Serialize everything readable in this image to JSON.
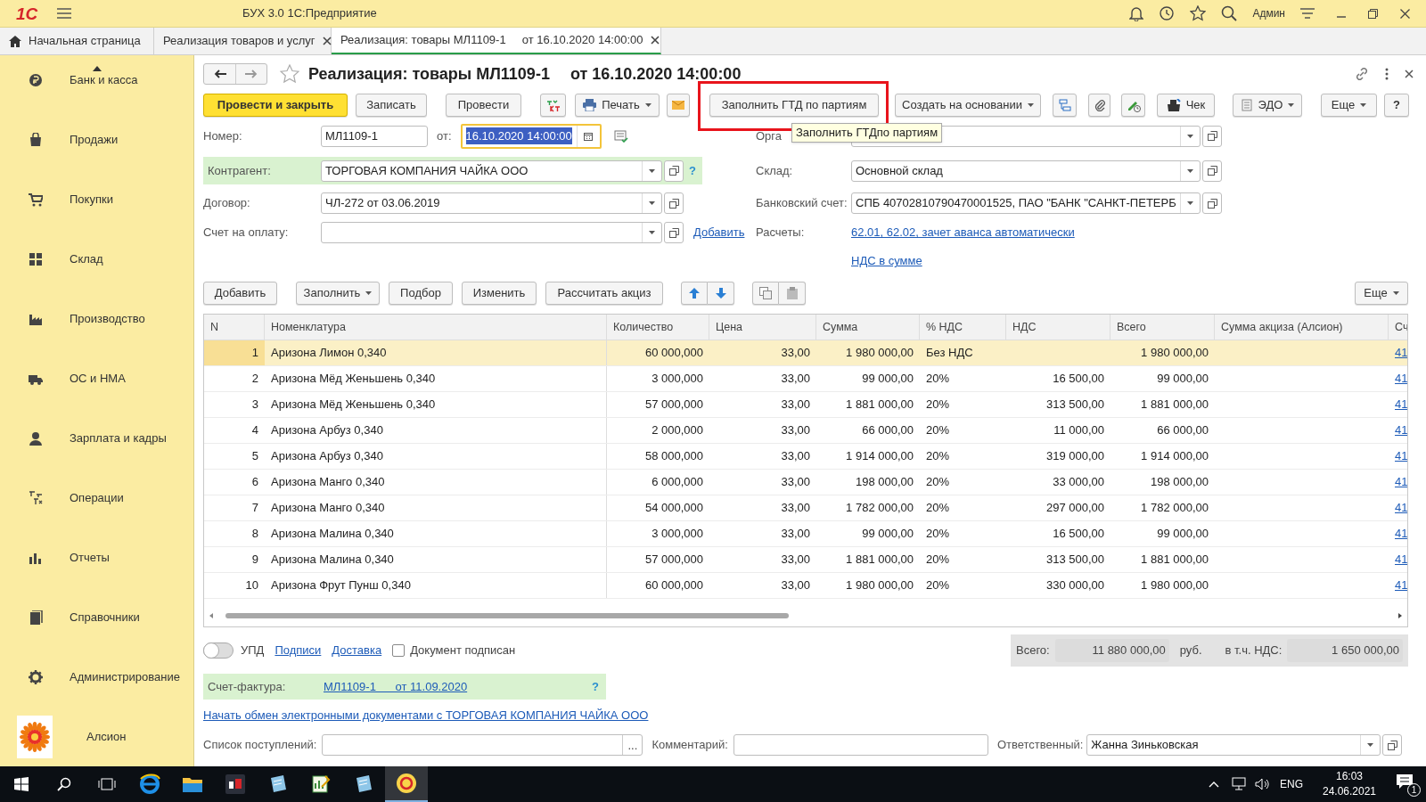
{
  "window": {
    "logo": "1С",
    "title": "БУХ 3.0 1С:Предприятие",
    "user": "Админ"
  },
  "tabs": [
    {
      "label": "Начальная страница",
      "selected": false,
      "closable": false
    },
    {
      "label": "Реализация товаров и услуг",
      "selected": false,
      "closable": true
    },
    {
      "label": "Реализация: товары МЛ1109-1     от 16.10.2020 14:00:00",
      "selected": true,
      "closable": true
    }
  ],
  "sidebar": {
    "items": [
      {
        "label": "Банк и касса"
      },
      {
        "label": "Продажи"
      },
      {
        "label": "Покупки"
      },
      {
        "label": "Склад"
      },
      {
        "label": "Производство"
      },
      {
        "label": "ОС и НМА"
      },
      {
        "label": "Зарплата и кадры"
      },
      {
        "label": "Операции"
      },
      {
        "label": "Отчеты"
      },
      {
        "label": "Справочники"
      },
      {
        "label": "Администрирование"
      },
      {
        "label": "Алсион"
      }
    ]
  },
  "document": {
    "title": "Реализация: товары МЛ1109-1",
    "date": "от 16.10.2020 14:00:00",
    "favorite": false
  },
  "toolbar": {
    "post_close": "Провести и закрыть",
    "save": "Записать",
    "post": "Провести",
    "print": "Печать",
    "fill_gtd": {
      "label": "Заполнить ГТД по партиям",
      "highlighted": true
    },
    "create_based": "Создать на основании",
    "receipt": "Чек",
    "edo": "ЭДО",
    "more": "Еще",
    "help": "?"
  },
  "tooltip": "Заполнить ГТДпо партиям",
  "fields": {
    "number": {
      "label": "Номер:",
      "value": "МЛ1109-1"
    },
    "date": {
      "label": "от:",
      "value": "16.10.2020 14:00:00",
      "selected": true
    },
    "counterparty": {
      "label": "Контрагент:",
      "value": "ТОРГОВАЯ КОМПАНИЯ ЧАЙКА ООО",
      "help": "?"
    },
    "contract": {
      "label": "Договор:",
      "value": "ЧЛ-272 от 03.06.2019"
    },
    "payment_invoice": {
      "label": "Счет на оплату:",
      "link": "Добавить"
    },
    "organization": {
      "label": "Орга"
    },
    "warehouse": {
      "label": "Склад:",
      "value": "Основной склад"
    },
    "bank_account": {
      "label": "Банковский счет:",
      "value": "СПБ 40702810790470001525, ПАО \"БАНК \"САНКТ-ПЕТЕРБ"
    },
    "settlements": {
      "label": "Расчеты:",
      "link": "62.01, 62.02, зачет аванса автоматически"
    },
    "vat_link": "НДС в сумме"
  },
  "table_toolbar": {
    "add": "Добавить",
    "fill": "Заполнить",
    "pick": "Подбор",
    "edit": "Изменить",
    "excise": "Рассчитать акциз",
    "more": "Еще"
  },
  "table": {
    "columns": [
      "N",
      "Номенклатура",
      "Количество",
      "Цена",
      "Сумма",
      "% НДС",
      "НДС",
      "Всего",
      "Сумма акциза (Алсион)",
      "Сч"
    ],
    "rows": [
      {
        "selected": true,
        "cells": [
          "1",
          "Аризона Лимон 0,340",
          "60 000,000",
          "33,00",
          "1 980 000,00",
          "Без НДС",
          "",
          "1 980 000,00",
          "",
          "41"
        ]
      },
      {
        "selected": false,
        "cells": [
          "2",
          "Аризона Мёд Женьшень 0,340",
          "3 000,000",
          "33,00",
          "99 000,00",
          "20%",
          "16 500,00",
          "99 000,00",
          "",
          "41"
        ]
      },
      {
        "selected": false,
        "cells": [
          "3",
          "Аризона Мёд Женьшень 0,340",
          "57 000,000",
          "33,00",
          "1 881 000,00",
          "20%",
          "313 500,00",
          "1 881 000,00",
          "",
          "41"
        ]
      },
      {
        "selected": false,
        "cells": [
          "4",
          "Аризона Арбуз 0,340",
          "2 000,000",
          "33,00",
          "66 000,00",
          "20%",
          "11 000,00",
          "66 000,00",
          "",
          "41"
        ]
      },
      {
        "selected": false,
        "cells": [
          "5",
          "Аризона Арбуз 0,340",
          "58 000,000",
          "33,00",
          "1 914 000,00",
          "20%",
          "319 000,00",
          "1 914 000,00",
          "",
          "41"
        ]
      },
      {
        "selected": false,
        "cells": [
          "6",
          "Аризона Манго 0,340",
          "6 000,000",
          "33,00",
          "198 000,00",
          "20%",
          "33 000,00",
          "198 000,00",
          "",
          "41"
        ]
      },
      {
        "selected": false,
        "cells": [
          "7",
          "Аризона Манго 0,340",
          "54 000,000",
          "33,00",
          "1 782 000,00",
          "20%",
          "297 000,00",
          "1 782 000,00",
          "",
          "41"
        ]
      },
      {
        "selected": false,
        "cells": [
          "8",
          "Аризона Малина 0,340",
          "3 000,000",
          "33,00",
          "99 000,00",
          "20%",
          "16 500,00",
          "99 000,00",
          "",
          "41"
        ]
      },
      {
        "selected": false,
        "cells": [
          "9",
          "Аризона Малина 0,340",
          "57 000,000",
          "33,00",
          "1 881 000,00",
          "20%",
          "313 500,00",
          "1 881 000,00",
          "",
          "41"
        ]
      },
      {
        "selected": false,
        "cells": [
          "10",
          "Аризона Фрут Пунш 0,340",
          "60 000,000",
          "33,00",
          "1 980 000,00",
          "20%",
          "330 000,00",
          "1 980 000,00",
          "",
          "41"
        ]
      }
    ]
  },
  "footer": {
    "upd": {
      "label": "УПД",
      "on": false
    },
    "links": [
      "Подписи",
      "Доставка"
    ],
    "signed": {
      "label": "Документ подписан",
      "checked": false
    },
    "totals": {
      "total_label": "Всего:",
      "total": "11 880 000,00",
      "currency": "руб.",
      "vat_label": "в т.ч. НДС:",
      "vat": "1 650 000,00"
    },
    "invoice": {
      "label": "Счет-фактура:",
      "link": "МЛ1109-1      от 11.09.2020",
      "help": "?"
    },
    "edo_link": "Начать обмен электронными документами с ТОРГОВАЯ КОМПАНИЯ ЧАЙКА ООО",
    "receipts": {
      "label": "Список поступлений:",
      "button": "..."
    },
    "comment": {
      "label": "Комментарий:"
    },
    "responsible": {
      "label": "Ответственный:",
      "value": "Жанна Зиньковская"
    }
  },
  "taskbar": {
    "language": "ENG",
    "time": "16:03",
    "date": "24.06.2021",
    "notifications": "1"
  }
}
